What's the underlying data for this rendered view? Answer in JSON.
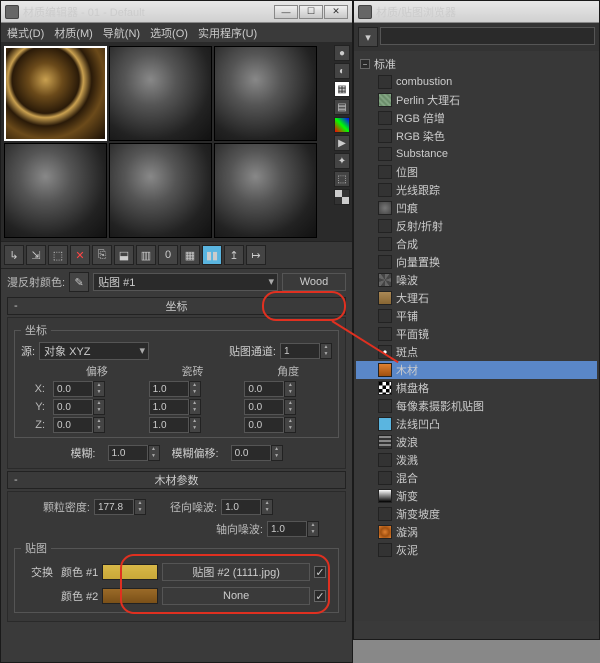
{
  "editor": {
    "title": "材质编辑器 - 01 - Default",
    "menu": [
      "模式(D)",
      "材质(M)",
      "导航(N)",
      "选项(O)",
      "实用程序(U)"
    ],
    "diffuse_label": "漫反射颜色:",
    "map_dropdown": "贴图 #1",
    "type_btn": "Wood",
    "rollcoord": "坐标",
    "coord": {
      "legend": "坐标",
      "source_label": "源:",
      "source_value": "对象 XYZ",
      "mapch_label": "贴图通道:",
      "mapch_value": "1",
      "headers": [
        "偏移",
        "瓷砖",
        "角度"
      ],
      "axes": [
        "X:",
        "Y:",
        "Z:"
      ],
      "offset": [
        "0.0",
        "0.0",
        "0.0"
      ],
      "tiling": [
        "1.0",
        "1.0",
        "1.0"
      ],
      "angle": [
        "0.0",
        "0.0",
        "0.0"
      ],
      "blur_label": "模糊:",
      "blur_value": "1.0",
      "bluroff_label": "模糊偏移:",
      "bluroff_value": "0.0"
    },
    "rollwood": "木材参数",
    "wood": {
      "grain_label": "颗粒密度:",
      "grain_value": "177.8",
      "radial_label": "径向噪波:",
      "radial_value": "1.0",
      "axial_label": "轴向噪波:",
      "axial_value": "1.0",
      "maps_legend": "贴图",
      "swap": "交换",
      "c1_label": "颜色 #1",
      "c2_label": "颜色 #2",
      "map1": "贴图 #2 (1111.jpg)",
      "map2": "None",
      "chk": "✓"
    }
  },
  "browser": {
    "title": "材质/贴图浏览器",
    "search_ph": "",
    "cat": "标准",
    "items": [
      {
        "label": "combustion",
        "ico": "blank"
      },
      {
        "label": "Perlin 大理石",
        "ico": "marble"
      },
      {
        "label": "RGB 倍增",
        "ico": "blank"
      },
      {
        "label": "RGB 染色",
        "ico": "blank"
      },
      {
        "label": "Substance",
        "ico": "blank"
      },
      {
        "label": "位图",
        "ico": "blank"
      },
      {
        "label": "光线跟踪",
        "ico": "blank"
      },
      {
        "label": "凹痕",
        "ico": "dent"
      },
      {
        "label": "反射/折射",
        "ico": "blank"
      },
      {
        "label": "合成",
        "ico": "blank"
      },
      {
        "label": "向量置换",
        "ico": "blank"
      },
      {
        "label": "噪波",
        "ico": "noise"
      },
      {
        "label": "大理石",
        "ico": "marble2"
      },
      {
        "label": "平铺",
        "ico": "blank"
      },
      {
        "label": "平面镜",
        "ico": "blank"
      },
      {
        "label": "斑点",
        "ico": "speck"
      },
      {
        "label": "木材",
        "ico": "wood",
        "sel": true
      },
      {
        "label": "棋盘格",
        "ico": "check"
      },
      {
        "label": "每像素摄影机贴图",
        "ico": "blank"
      },
      {
        "label": "法线凹凸",
        "ico": "blue"
      },
      {
        "label": "波浪",
        "ico": "wave"
      },
      {
        "label": "泼溅",
        "ico": "blank"
      },
      {
        "label": "混合",
        "ico": "blank"
      },
      {
        "label": "渐变",
        "ico": "grad"
      },
      {
        "label": "渐变坡度",
        "ico": "blank"
      },
      {
        "label": "漩涡",
        "ico": "swirl"
      },
      {
        "label": "灰泥",
        "ico": "blank"
      }
    ]
  }
}
